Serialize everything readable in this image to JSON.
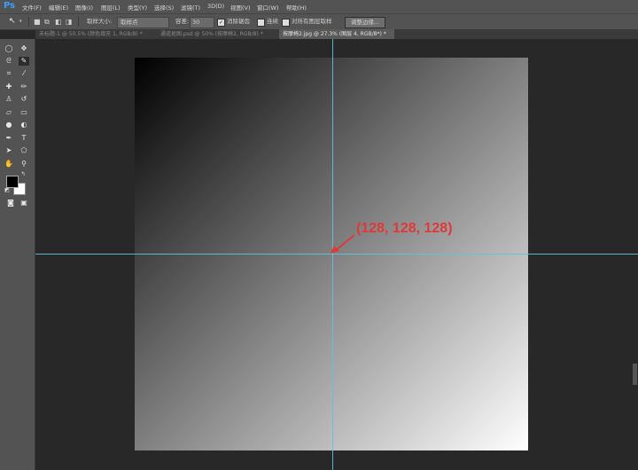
{
  "app": {
    "logo": "Ps"
  },
  "menu": [
    "文件(F)",
    "编辑(E)",
    "图像(I)",
    "图层(L)",
    "类型(Y)",
    "选择(S)",
    "滤镜(T)",
    "3D(D)",
    "视图(V)",
    "窗口(W)",
    "帮助(H)"
  ],
  "options": {
    "sample_size_label": "取样大小:",
    "sample_size_value": "取样点",
    "tolerance_label": "容差:",
    "tolerance_value": "30",
    "antialias_label": "消除锯齿",
    "contiguous_label": "连续",
    "all_layers_label": "对所有图层取样",
    "refine_edge_button": "调整边缘..."
  },
  "tabs": [
    {
      "label": "未标题-1 @ 50.5% (颜色填充 1, RGB/8) *",
      "active": false
    },
    {
      "label": "通道抠图.psd @ 50% (按摩椅2, RGB/8) *",
      "active": false
    },
    {
      "label": "按摩椅2.jpg @ 27.3% (图层 4, RGB/8*) *",
      "active": true
    }
  ],
  "annotation": {
    "text": "(128, 128, 128)",
    "color": "#e03838"
  },
  "guides": {
    "color": "#5fc2d8"
  },
  "colors": {
    "foreground": "#000000",
    "background": "#ffffff",
    "ui_panel": "#535353",
    "canvas_bg": "#282828"
  },
  "icons": [
    "marquee-icon",
    "move-icon",
    "lasso-icon",
    "quick-select-icon",
    "crop-icon",
    "eyedropper-icon",
    "healing-icon",
    "brush-icon",
    "stamp-icon",
    "history-brush-icon",
    "eraser-icon",
    "gradient-icon",
    "blur-icon",
    "dodge-icon",
    "pen-icon",
    "type-icon",
    "path-select-icon",
    "shape-icon",
    "hand-icon",
    "zoom-icon"
  ]
}
